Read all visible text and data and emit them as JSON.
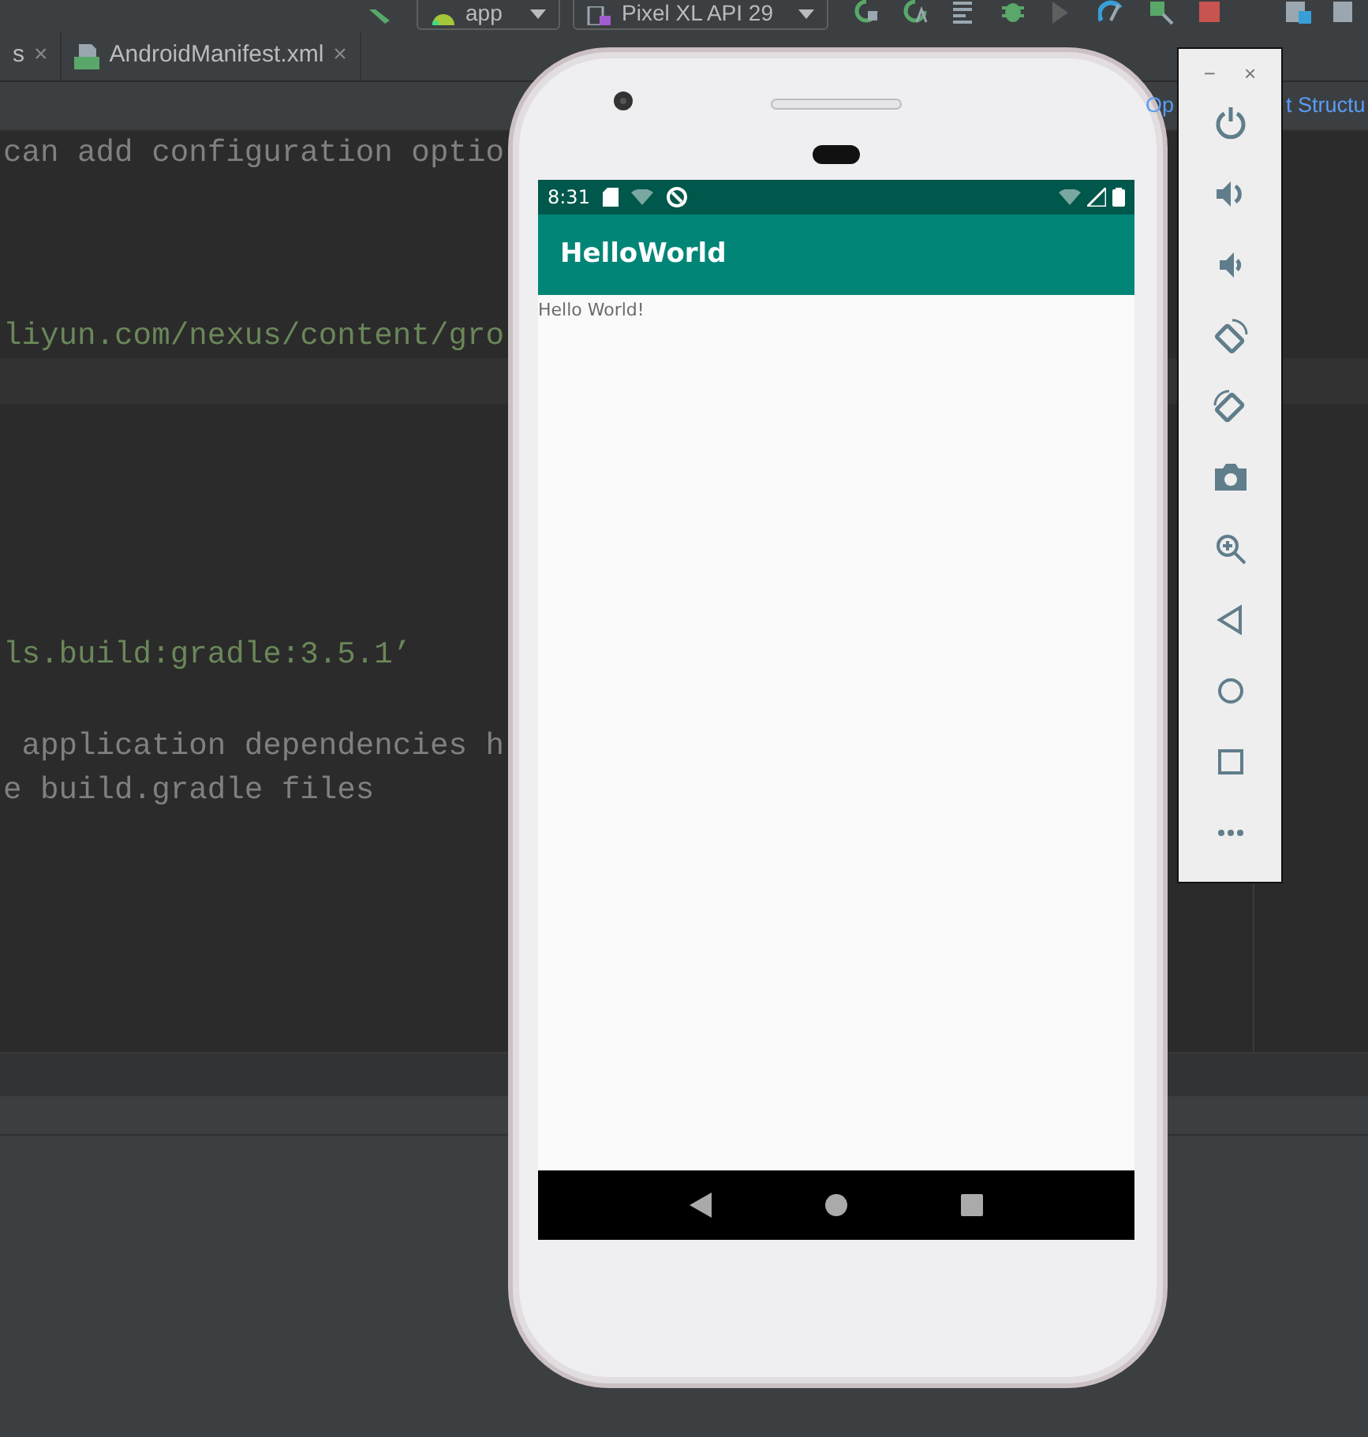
{
  "toolbar": {
    "run_config": "app",
    "device": "Pixel XL API 29"
  },
  "editor_tabs": [
    {
      "label": "s",
      "close": "×",
      "kind": "plain"
    },
    {
      "label": "AndroidManifest.xml",
      "close": "×",
      "kind": "manifest"
    }
  ],
  "notification_link_parts": [
    "Op",
    "t Structu"
  ],
  "code_lines": [
    {
      "text": "can add configuration optio",
      "kind": "comment"
    },
    {
      "kind": "blank"
    },
    {
      "kind": "blank"
    },
    {
      "kind": "blank"
    },
    {
      "text": "liyun.com/nexus/content/gro",
      "kind": "string"
    },
    {
      "kind": "caret_line"
    },
    {
      "kind": "blank"
    },
    {
      "kind": "blank"
    },
    {
      "kind": "blank"
    },
    {
      "kind": "blank"
    },
    {
      "kind": "blank"
    },
    {
      "text": "ls.build:gradle:3.5.1’",
      "kind": "string"
    },
    {
      "kind": "blank"
    },
    {
      "text": " application dependencies h",
      "kind": "comment"
    },
    {
      "text": "e build.gradle files",
      "kind": "comment"
    }
  ],
  "emulator": {
    "status_time": "8:31",
    "app_title": "HelloWorld",
    "body_text": "Hello World!"
  },
  "emulator_panel": {
    "minimize": "−",
    "close": "×"
  }
}
